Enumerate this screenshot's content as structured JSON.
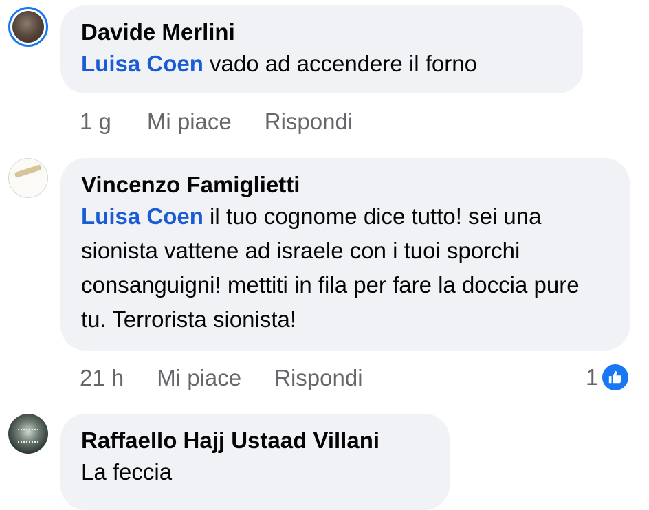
{
  "comments": [
    {
      "author": "Davide Merlini",
      "mention": "Luisa Coen",
      "text": " vado ad accendere il forno",
      "time": "1 g",
      "like_label": "Mi piace",
      "reply_label": "Rispondi",
      "avatar_icon": "user-avatar-icon"
    },
    {
      "author": "Vincenzo Famiglietti",
      "mention": "Luisa Coen",
      "text": " il tuo cognome dice tutto! sei una sionista vattene ad israele con i tuoi sporchi consanguigni! mettiti in fila per fare la doccia pure tu. Terrorista sionista!",
      "time": "21 h",
      "like_label": "Mi piace",
      "reply_label": "Rispondi",
      "reaction_count": "1",
      "reaction_icon": "thumbs-up-icon",
      "avatar_icon": "user-avatar-icon"
    },
    {
      "author": "Raffaello Hajj Ustaad Villani",
      "text": "La feccia",
      "avatar_icon": "user-avatar-icon"
    }
  ],
  "colors": {
    "bubble": "#f0f2f5",
    "mention": "#1a5bd6",
    "meta": "#65676b",
    "like_blue": "#1877f2"
  }
}
